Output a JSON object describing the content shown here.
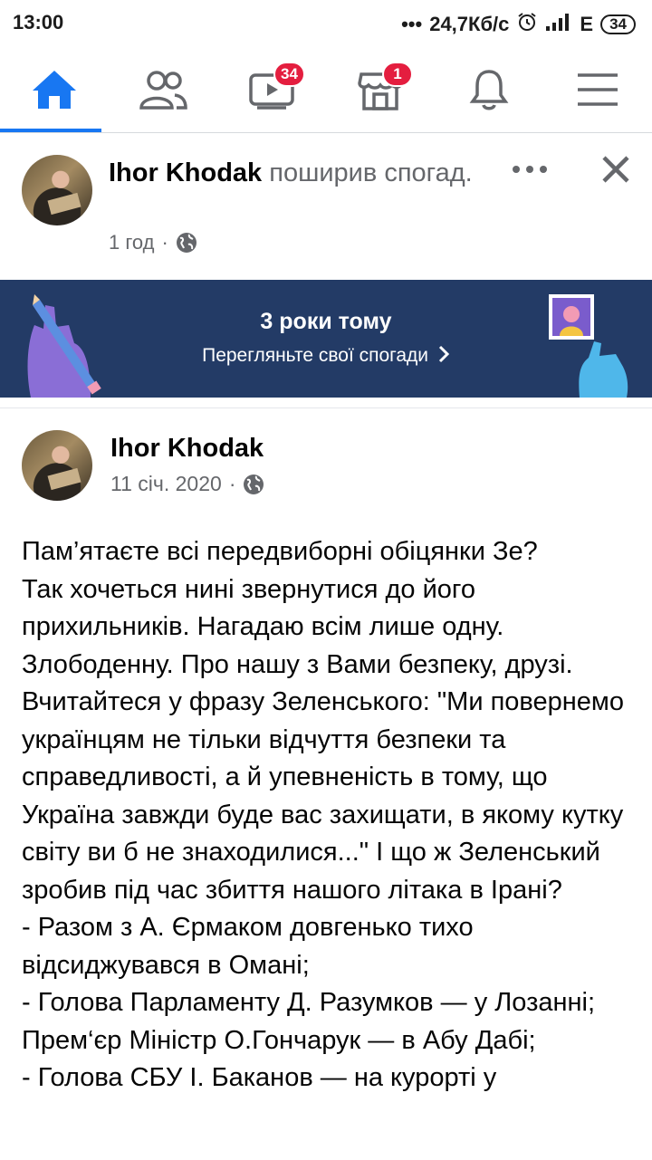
{
  "status_bar": {
    "time": "13:00",
    "speed": "24,7Кб/с",
    "network": "E",
    "battery": "34"
  },
  "nav": {
    "items": [
      {
        "name": "home",
        "active": true
      },
      {
        "name": "friends"
      },
      {
        "name": "watch",
        "badge": "34"
      },
      {
        "name": "marketplace",
        "badge": "1"
      },
      {
        "name": "notifications"
      },
      {
        "name": "menu"
      }
    ]
  },
  "share_post": {
    "author": "Ihor Khodak",
    "action": "поширив спогад.",
    "time": "1 год"
  },
  "memory_banner": {
    "title": "3 роки тому",
    "subtitle": "Перегляньте свої спогади"
  },
  "original_post": {
    "author": "Ihor Khodak",
    "date": "11 січ. 2020",
    "text": "Пам’ятаєте всі передвиборні обіцянки Зе?\nТак хочеться нині звернутися до його прихильників. Нагадаю всім лише одну. Злободенну. Про нашу з Вами безпеку, друзі. Вчитайтеся у фразу Зеленського: \"Ми повернемо українцям не тільки відчуття безпеки та справедливості, а й упевненість в тому, що Україна завжди буде вас захищати, в якому кутку світу ви б не знаходилися...\" І що ж Зеленський зробив під час збиття нашого літака в Ірані?\n- Разом з А. Єрмаком довгенько тихо відсиджувався в Омані;\n- Голова Парламенту Д. Разумков —  у Лозанні;\nПрем‘єр Міністр О.Гончарук — в Абу Дабі;\n- Голова СБУ І. Баканов — на курорті у"
  },
  "colors": {
    "accent": "#1877f2",
    "badge": "#e41e3f",
    "banner_bg": "#233b66"
  }
}
